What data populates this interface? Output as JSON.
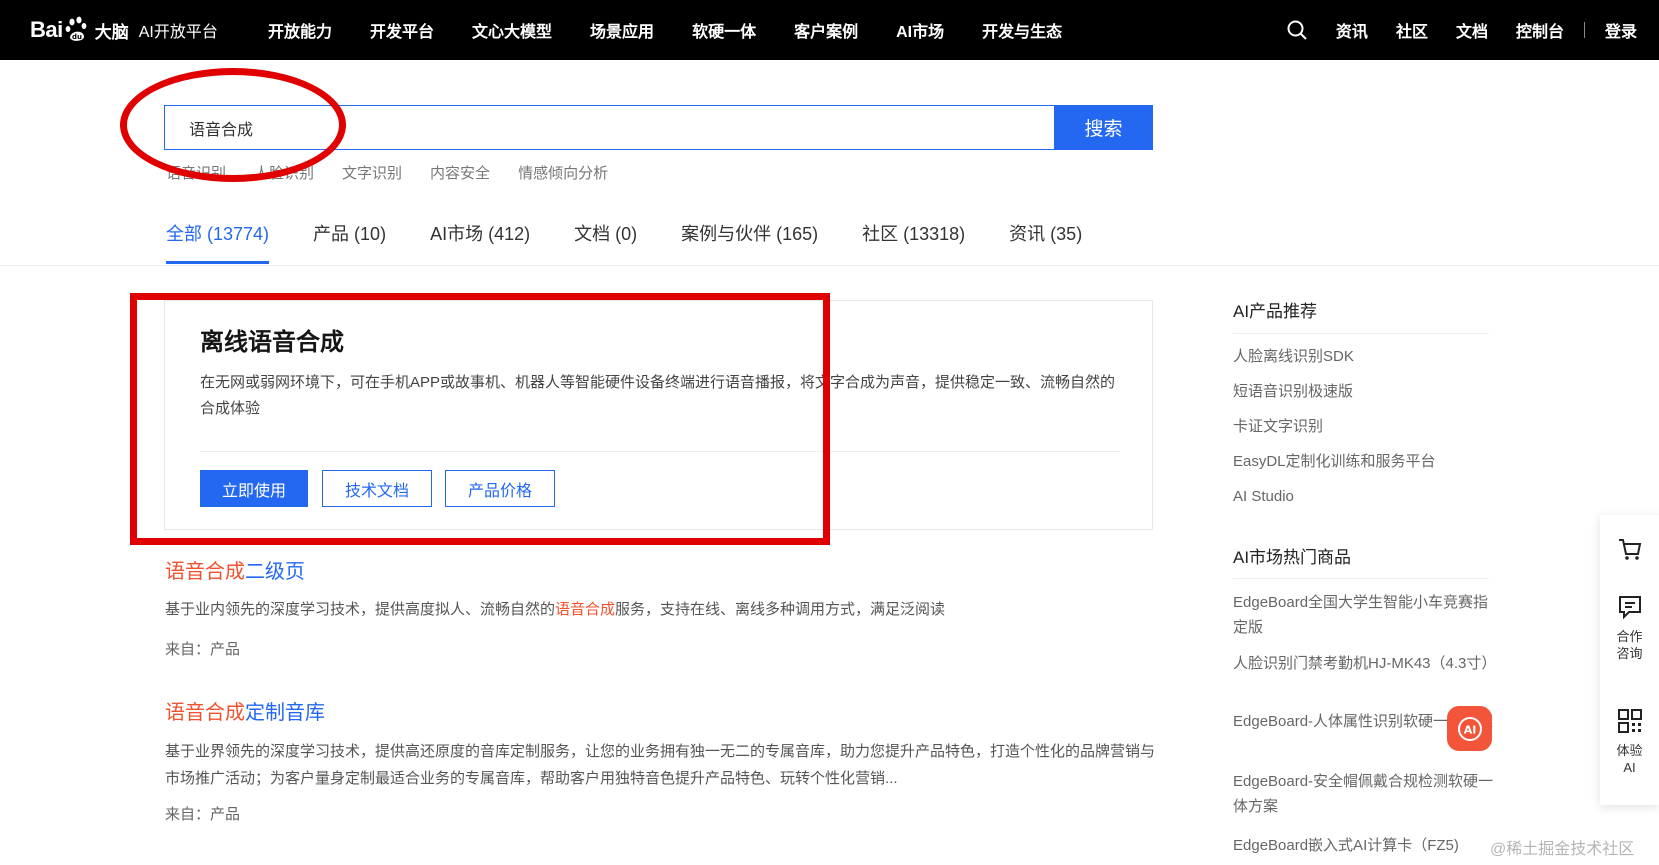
{
  "header": {
    "logo_text": "Bai",
    "logo_suffix": "大脑",
    "logo_sub": "AI开放平台",
    "nav_items": [
      "开放能力",
      "开发平台",
      "文心大模型",
      "场景应用",
      "软硬一体",
      "客户案例",
      "AI市场",
      "开发与生态"
    ],
    "right_items": [
      "资讯",
      "社区",
      "文档",
      "控制台",
      "登录"
    ]
  },
  "search": {
    "value": "语音合成",
    "button_label": "搜索",
    "hot_tags": [
      "语音识别",
      "人脸识别",
      "文字识别",
      "内容安全",
      "情感倾向分析"
    ]
  },
  "tabs": [
    {
      "label": "全部 (13774)",
      "active": true
    },
    {
      "label": "产品 (10)",
      "active": false
    },
    {
      "label": "AI市场 (412)",
      "active": false
    },
    {
      "label": "文档 (0)",
      "active": false
    },
    {
      "label": "案例与伙伴 (165)",
      "active": false
    },
    {
      "label": "社区 (13318)",
      "active": false
    },
    {
      "label": "资讯 (35)",
      "active": false
    }
  ],
  "product": {
    "title": "离线语音合成",
    "description": "在无网或弱网环境下，可在手机APP或故事机、机器人等智能硬件设备终端进行语音播报，将文字合成为声音，提供稳定一致、流畅自然的合成体验",
    "primary_button": "立即使用",
    "doc_button": "技术文档",
    "price_button": "产品价格"
  },
  "results": [
    {
      "title_hl": "语音合成",
      "title_rest": "二级页",
      "desc_pre": "基于业内领先的深度学习技术，提供高度拟人、流畅自然的",
      "desc_hl": "语音合成",
      "desc_post": "服务，支持在线、离线多种调用方式，满足泛阅读",
      "from": "来自：产品"
    },
    {
      "title_hl": "语音合成",
      "title_rest": "定制音库",
      "desc_pre": "基于业界领先的深度学习技术，提供高还原度的音库定制服务，让您的业务拥有独一无二的专属音库，助力您提升产品特色，打造个性化的品牌营销与市场推广活动；为客户量身定制最适合业务的专属音库，帮助客户用独特音色提升产品特色、玩转个性化营销...",
      "desc_hl": "",
      "desc_post": "",
      "from": "来自：产品"
    }
  ],
  "sidebar": {
    "recommend_heading": "AI产品推荐",
    "recommend_items": [
      "人脸离线识别SDK",
      "短语音识别极速版",
      "卡证文字识别",
      "EasyDL定制化训练和服务平台",
      "AI Studio"
    ],
    "market_heading": "AI市场热门商品",
    "market_items": [
      "EdgeBoard全国大学生智能小车竞赛指定版",
      "人脸识别门禁考勤机HJ-MK43（4.3寸）",
      "EdgeBoard-人体属性识别软硬一体方案",
      "EdgeBoard-安全帽佩戴合规检测软硬一体方案",
      "EdgeBoard嵌入式AI计算卡（FZ5)"
    ]
  },
  "float_panel": {
    "consult_label": "合作咨询",
    "experience_label": "体验AI"
  },
  "ai_bubble": "AI",
  "watermark": "@稀土掘金技术社区",
  "colors": {
    "accent": "#2468f2",
    "highlight": "#f0522f",
    "annotation_red": "#e00000",
    "nav_bg": "#000000"
  }
}
